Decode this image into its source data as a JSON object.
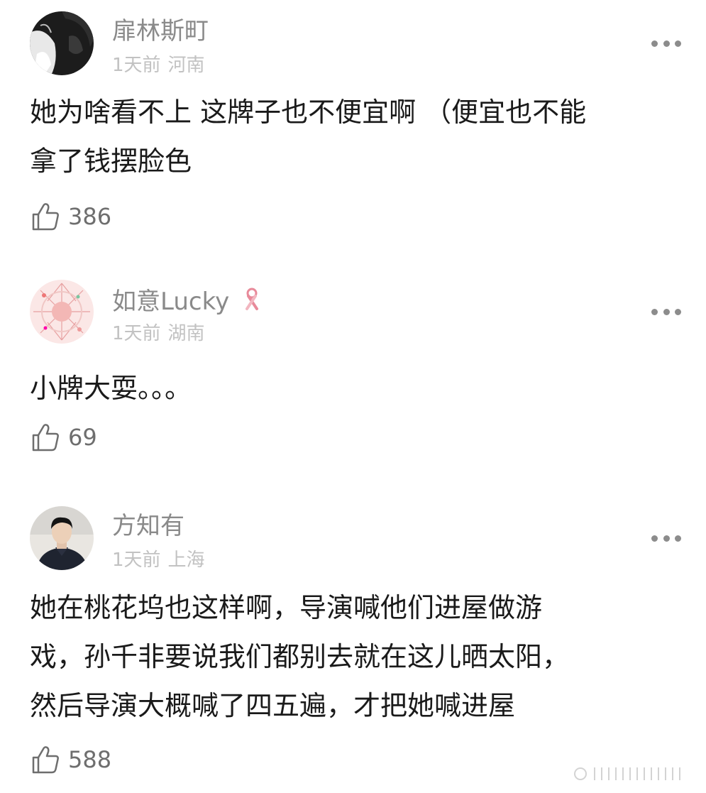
{
  "comments": [
    {
      "username": "扉林斯町",
      "time": "1天前",
      "location": "河南",
      "lines": [
        "她为啥看不上 这牌子也不便宜啊 （便宜也不能",
        "拿了钱摆脸色"
      ],
      "likes": "386",
      "avatar_icon": "dark-anime-avatar"
    },
    {
      "username": "如意Lucky",
      "time": "1天前",
      "location": "湖南",
      "lines": [
        "小牌大耍。。。"
      ],
      "likes": "69",
      "avatar_icon": "pink-floral-avatar",
      "badge_icon": "pink-ribbon-icon"
    },
    {
      "username": "方知有",
      "time": "1天前",
      "location": "上海",
      "lines": [
        "她在桃花坞也这样啊，导演喊他们进屋做游",
        "戏，孙千非要说我们都别去就在这儿晒太阳，",
        "然后导演大概喊了四五遍，才把她喊进屋"
      ],
      "likes": "588",
      "avatar_icon": "man-photo-avatar"
    }
  ],
  "colors": {
    "username": "#8a8a8a",
    "meta": "#c2c2c2",
    "text": "#1a1a1a",
    "like": "#6e6e6e"
  }
}
